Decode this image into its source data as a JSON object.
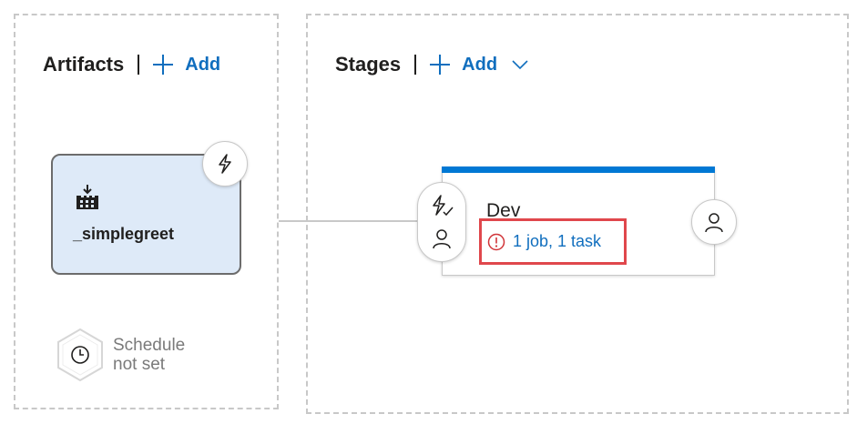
{
  "artifacts": {
    "title": "Artifacts",
    "add_label": "Add",
    "items": [
      {
        "name": "_simplegreet",
        "icon": "build-icon"
      }
    ],
    "schedule": {
      "line1": "Schedule",
      "line2": "not set",
      "icon": "clock-icon"
    }
  },
  "stages": {
    "title": "Stages",
    "add_label": "Add",
    "items": [
      {
        "name": "Dev",
        "tasks_summary": "1 job, 1 task",
        "status_icon": "error-icon"
      }
    ]
  },
  "colors": {
    "link": "#106ebe",
    "stage_accent": "#0078d4",
    "artifact_bg": "#deeaf8",
    "highlight_border": "#e0474c",
    "error": "#d13438"
  }
}
